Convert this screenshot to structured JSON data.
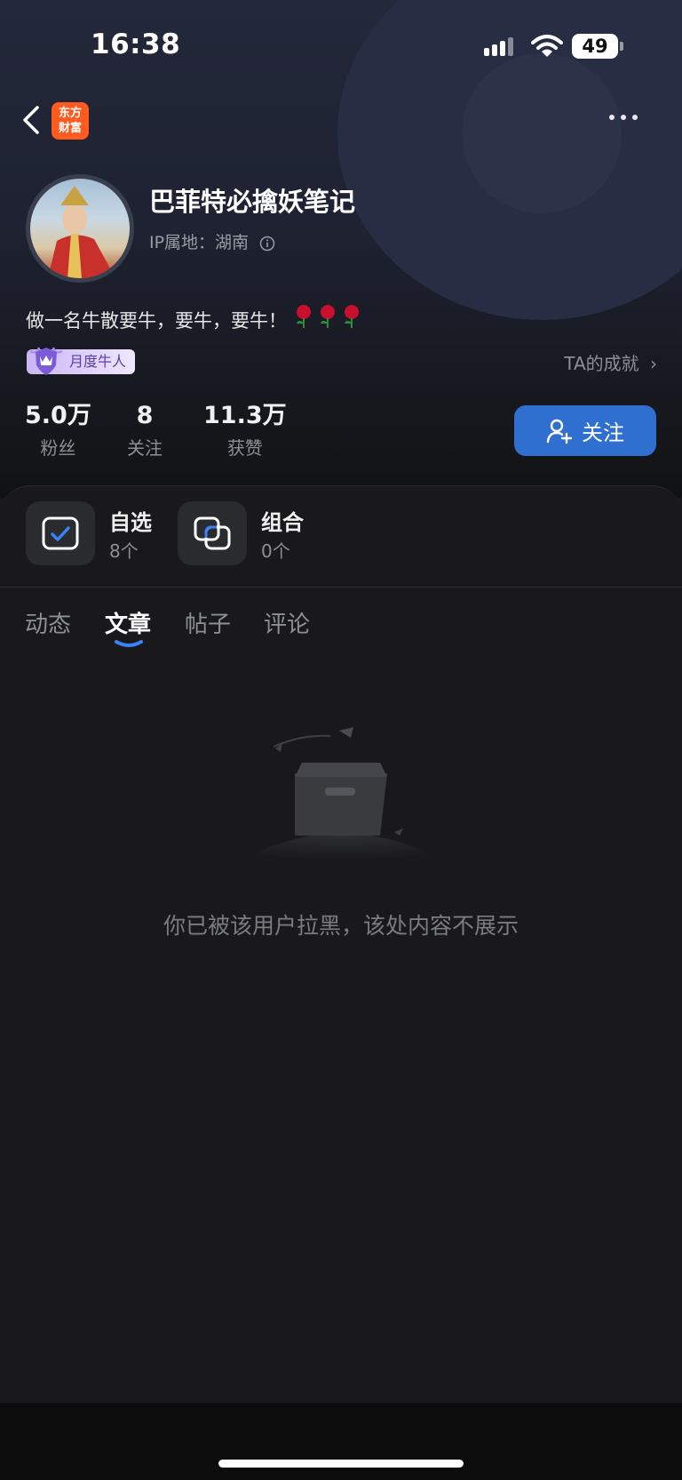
{
  "status": {
    "time": "16:38",
    "battery": "49"
  },
  "nav": {
    "logo_line1": "东方",
    "logo_line2": "财富"
  },
  "profile": {
    "name": "巴菲特必擒妖笔记",
    "ip_label": "IP属地：湖南",
    "bio": "做一名牛散要牛，要牛，要牛！",
    "badge": "月度牛人",
    "achievements": "TA的成就"
  },
  "stats": [
    {
      "value": "5.0万",
      "label": "粉丝"
    },
    {
      "value": "8",
      "label": "关注"
    },
    {
      "value": "11.3万",
      "label": "获赞"
    }
  ],
  "follow_button": "关注",
  "cards": [
    {
      "title": "自选",
      "count": "8个"
    },
    {
      "title": "组合",
      "count": "0个"
    }
  ],
  "tabs": [
    "动态",
    "文章",
    "帖子",
    "评论"
  ],
  "active_tab": "文章",
  "empty_message": "你已被该用户拉黑，该处内容不展示",
  "colors": {
    "accent": "#2e6fd0",
    "logo": "#ff5a1f",
    "background": "#19191b"
  }
}
